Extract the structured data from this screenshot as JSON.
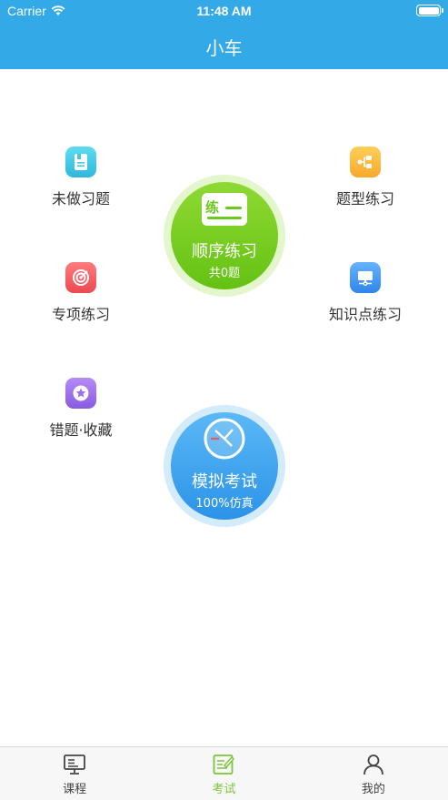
{
  "status_bar": {
    "carrier": "Carrier",
    "time": "11:48 AM"
  },
  "nav": {
    "title": "小车"
  },
  "menu": {
    "undone": {
      "label": "未做习题",
      "icon": "notebook-icon",
      "color": "#3fc8e4"
    },
    "type_practice": {
      "label": "题型练习",
      "icon": "branch-icon",
      "color": "#fbb43f"
    },
    "special_practice": {
      "label": "专项练习",
      "icon": "target-icon",
      "color": "#f0585c"
    },
    "knowledge_practice": {
      "label": "知识点练习",
      "icon": "monitor-icon",
      "color": "#3f96f2"
    },
    "wrong_favorites": {
      "label": "错题·收藏",
      "icon": "star-icon",
      "color": "#9c6ee8"
    }
  },
  "sequential": {
    "badge": "练",
    "title": "顺序练习",
    "subtitle": "共0题",
    "color": "#6cc81d"
  },
  "mock_exam": {
    "title": "模拟考试",
    "subtitle": "100%仿真",
    "icon": "clock-icon",
    "color": "#3aa2ee"
  },
  "tabbar": {
    "tabs": [
      {
        "label": "课程",
        "icon": "course-monitor-icon",
        "active": false
      },
      {
        "label": "考试",
        "icon": "exam-edit-icon",
        "active": true
      },
      {
        "label": "我的",
        "icon": "person-icon",
        "active": false
      }
    ],
    "active_color": "#7cc43a"
  }
}
